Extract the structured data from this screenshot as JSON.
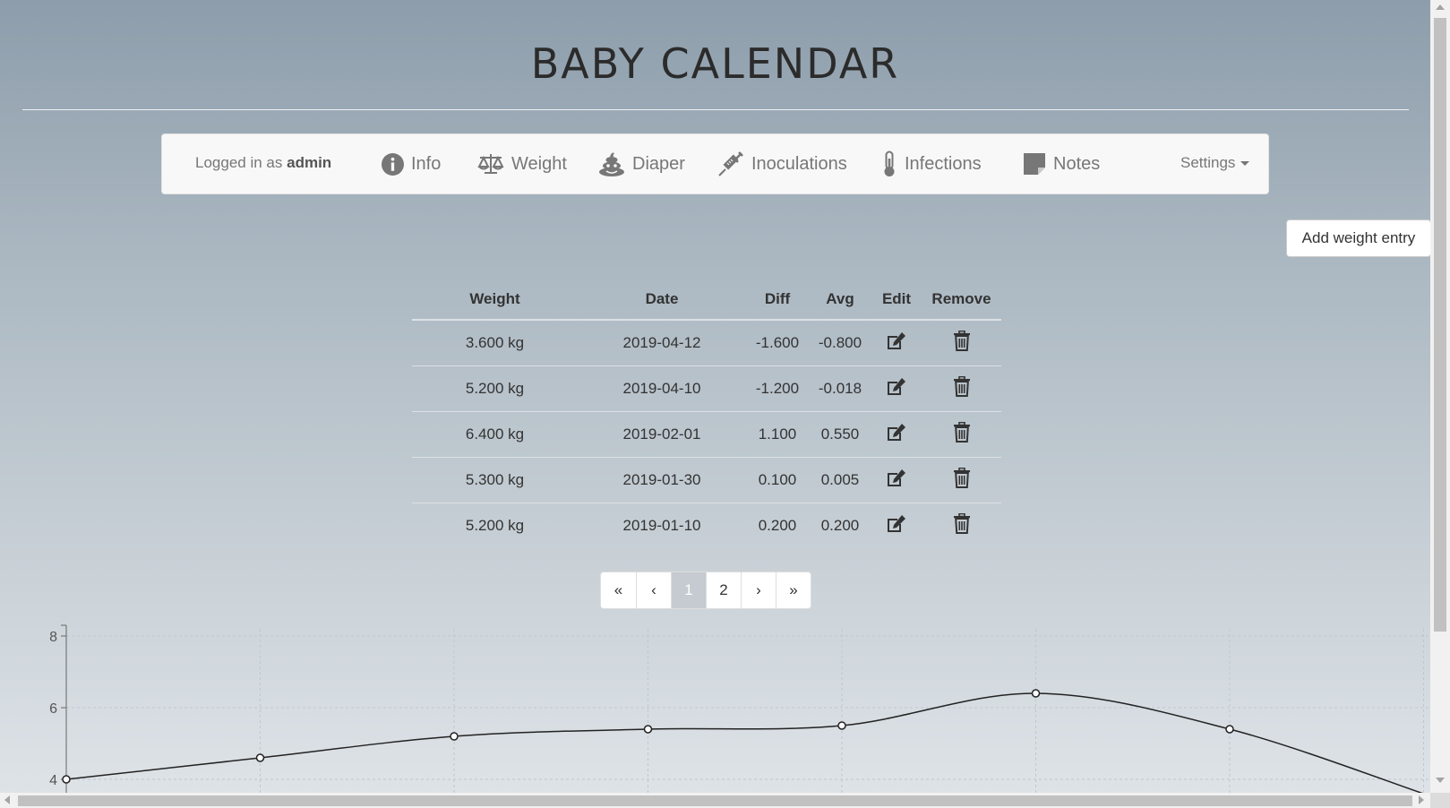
{
  "app": {
    "title": "BABY CALENDAR"
  },
  "nav": {
    "login_prefix": "Logged in as",
    "user": "admin",
    "items": [
      {
        "label": "Info",
        "icon": "info-icon"
      },
      {
        "label": "Weight",
        "icon": "scale-icon"
      },
      {
        "label": "Diaper",
        "icon": "poop-icon"
      },
      {
        "label": "Inoculations",
        "icon": "syringe-icon"
      },
      {
        "label": "Infections",
        "icon": "thermometer-icon"
      },
      {
        "label": "Notes",
        "icon": "sticky-note-icon"
      }
    ],
    "settings_label": "Settings"
  },
  "add_button": "Add weight entry",
  "table": {
    "headers": [
      "Weight",
      "Date",
      "Diff",
      "Avg",
      "Edit",
      "Remove"
    ],
    "rows": [
      [
        "3.600 kg",
        "2019-04-12",
        "-1.600",
        "-0.800"
      ],
      [
        "5.200 kg",
        "2019-04-10",
        "-1.200",
        "-0.018"
      ],
      [
        "6.400 kg",
        "2019-02-01",
        "1.100",
        "0.550"
      ],
      [
        "5.300 kg",
        "2019-01-30",
        "0.100",
        "0.005"
      ],
      [
        "5.200 kg",
        "2019-01-10",
        "0.200",
        "0.200"
      ]
    ]
  },
  "pagination": {
    "items": [
      "«",
      "‹",
      "1",
      "2",
      "›",
      "»"
    ],
    "active": "1"
  },
  "colors": {
    "line": "#222222",
    "grid": "#bfc7ce",
    "axis": "#666666"
  },
  "chart_data": {
    "type": "line",
    "y_ticks": [
      "4",
      "6",
      "8"
    ],
    "ylim": [
      4,
      8
    ],
    "x_index": [
      0,
      1,
      2,
      3,
      4,
      5,
      6,
      7
    ],
    "values": [
      4.0,
      4.6,
      5.2,
      5.4,
      5.5,
      6.4,
      5.4,
      3.6
    ],
    "grid": true
  }
}
